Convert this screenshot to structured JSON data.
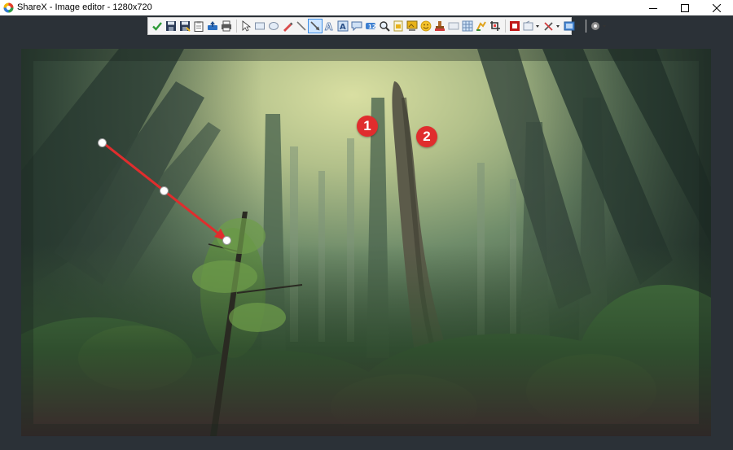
{
  "window": {
    "title": "ShareX - Image editor - 1280x720",
    "controls": {
      "minimize": "minimize-icon",
      "maximize": "maximize-icon",
      "close": "close-icon"
    }
  },
  "toolbar": {
    "tools": [
      {
        "id": "confirm",
        "icon": "checkmark-icon"
      },
      {
        "id": "save",
        "icon": "save-icon"
      },
      {
        "id": "save-as",
        "icon": "save-as-icon"
      },
      {
        "id": "copy",
        "icon": "clipboard-icon"
      },
      {
        "id": "upload",
        "icon": "upload-icon"
      },
      {
        "id": "print",
        "icon": "print-icon"
      },
      {
        "id": "select",
        "icon": "cursor-icon"
      },
      {
        "id": "rectangle",
        "icon": "rectangle-icon"
      },
      {
        "id": "ellipse",
        "icon": "ellipse-icon"
      },
      {
        "id": "freehand",
        "icon": "pen-icon"
      },
      {
        "id": "line",
        "icon": "line-icon"
      },
      {
        "id": "arrow",
        "icon": "arrow-icon",
        "active": true
      },
      {
        "id": "text-outline",
        "icon": "text-outline-icon"
      },
      {
        "id": "text-background",
        "icon": "text-background-icon"
      },
      {
        "id": "speech-balloon",
        "icon": "speech-balloon-icon"
      },
      {
        "id": "step",
        "icon": "step-icon"
      },
      {
        "id": "magnify",
        "icon": "magnify-icon"
      },
      {
        "id": "image-file",
        "icon": "image-file-icon"
      },
      {
        "id": "image-screen",
        "icon": "image-screen-icon"
      },
      {
        "id": "sticker",
        "icon": "smiley-icon"
      },
      {
        "id": "cursor-stamp",
        "icon": "stamp-icon"
      },
      {
        "id": "smart-eraser",
        "icon": "eraser-icon"
      },
      {
        "id": "blur",
        "icon": "blur-icon"
      },
      {
        "id": "pixelate",
        "icon": "pixelate-icon"
      },
      {
        "id": "highlight",
        "icon": "highlight-icon"
      },
      {
        "id": "crop",
        "icon": "crop-icon"
      },
      {
        "id": "border-color",
        "icon": "border-color-icon"
      },
      {
        "id": "fill-options",
        "icon": "fill-icon"
      },
      {
        "id": "edit-tools",
        "icon": "tools-icon"
      },
      {
        "id": "canvas",
        "icon": "canvas-icon"
      },
      {
        "id": "settings",
        "icon": "gear-icon"
      }
    ]
  },
  "annotations": {
    "step_1": "1",
    "step_2": "2",
    "arrow_color": "#e02d2d",
    "step_color": "#e02d2d"
  },
  "image": {
    "description_icon": "forest-photo"
  }
}
